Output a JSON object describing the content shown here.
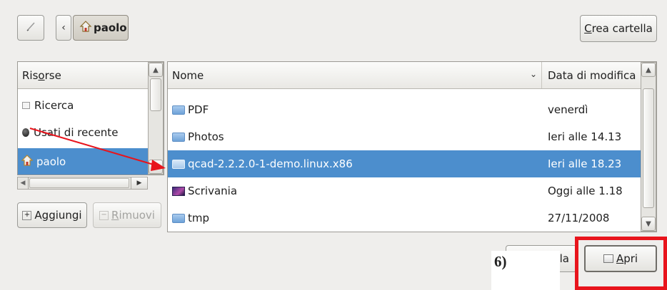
{
  "toolbar": {
    "create_folder_label": "Crea cartella",
    "path_button_label": "paolo"
  },
  "sidebar": {
    "header": "Risorse",
    "items": [
      {
        "label": "Ricerca",
        "icon": "search-icon"
      },
      {
        "label": "Usati di recente",
        "icon": "recent-icon"
      },
      {
        "label": "paolo",
        "icon": "home-icon",
        "selected": true
      }
    ],
    "add_label": "Aggiungi",
    "remove_label": "Rimuovi"
  },
  "files": {
    "col_name": "Nome",
    "col_modified": "Data di modifica",
    "rows": [
      {
        "name": "PDF",
        "modified": "venerdì"
      },
      {
        "name": "Photos",
        "modified": "Ieri alle 14.13"
      },
      {
        "name": "qcad-2.2.2.0-1-demo.linux.x86",
        "modified": "Ieri alle 18.23",
        "selected": true
      },
      {
        "name": "Scrivania",
        "modified": "Oggi alle 1.18"
      },
      {
        "name": "tmp",
        "modified": "27/11/2008"
      }
    ]
  },
  "footer": {
    "cancel_label_visible": "la",
    "open_label": "Apri"
  },
  "annotation": {
    "step_label": "6)",
    "highlight_color": "#e8141c",
    "arrow_color": "#e8141c"
  },
  "colors": {
    "selection": "#4c8ecd",
    "dialog_bg": "#efeeec"
  }
}
